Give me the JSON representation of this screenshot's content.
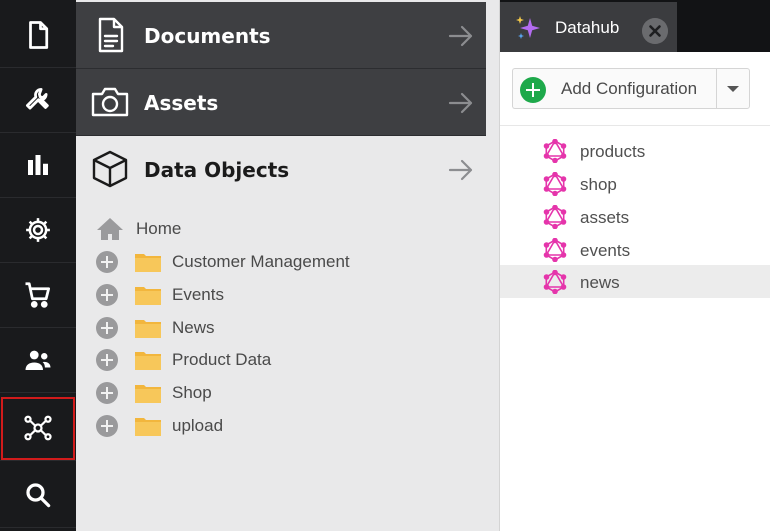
{
  "rail": {
    "items": [
      {
        "name": "documents-icon"
      },
      {
        "name": "wrench-icon"
      },
      {
        "name": "bar-chart-icon"
      },
      {
        "name": "gear-icon"
      },
      {
        "name": "shopping-cart-icon"
      },
      {
        "name": "users-icon"
      },
      {
        "name": "network-hub-icon",
        "active": true
      },
      {
        "name": "search-icon"
      }
    ],
    "active_outline_color": "#d21b1b"
  },
  "tree_panel": {
    "accordions": [
      {
        "label": "Documents",
        "icon": "document-icon",
        "arrow_icon": "arrow-right-icon"
      },
      {
        "label": "Assets",
        "icon": "camera-icon",
        "arrow_icon": "arrow-right-icon"
      },
      {
        "label": "Data Objects",
        "icon": "cube-icon",
        "arrow_icon": "arrow-right-icon"
      }
    ],
    "home": {
      "label": "Home",
      "icon": "home-icon"
    },
    "folders": [
      {
        "label": "Customer Management"
      },
      {
        "label": "Events"
      },
      {
        "label": "News"
      },
      {
        "label": "Product Data"
      },
      {
        "label": "Shop"
      },
      {
        "label": "upload"
      }
    ]
  },
  "tab": {
    "label": "Datahub",
    "icon": "sparkle-icon",
    "close_icon": "close-icon"
  },
  "toolbar": {
    "add_label": "Add Configuration",
    "add_icon": "plus-circle-icon",
    "dropdown_icon": "chevron-down-icon",
    "accent": "#1ea94b"
  },
  "configurations": {
    "icon": "graphql-icon",
    "icon_color": "#e535ab",
    "items": [
      {
        "label": "products"
      },
      {
        "label": "shop"
      },
      {
        "label": "assets"
      },
      {
        "label": "events"
      },
      {
        "label": "news",
        "selected": true
      }
    ]
  }
}
